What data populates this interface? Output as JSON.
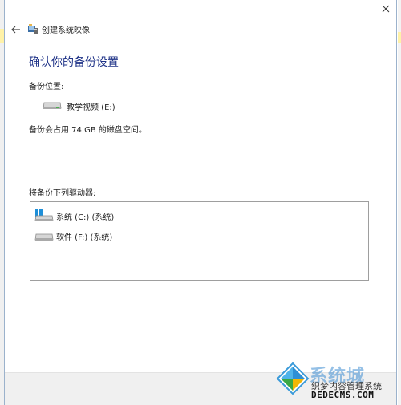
{
  "window": {
    "title": "创建系统映像"
  },
  "main": {
    "heading": "确认你的备份设置",
    "location_label": "备份位置:",
    "location_value": "教学视频 (E:)",
    "usage_text": "备份会占用 74 GB 的磁盘空间。",
    "drives_label": "将备份下列驱动器:",
    "drives": [
      {
        "label": "系统 (C:) (系统)",
        "icon": "windows-drive-icon"
      },
      {
        "label": "软件 (F:) (系统)",
        "icon": "drive-icon"
      }
    ]
  },
  "watermark": {
    "big_text": "系统城",
    "sub_text": "织梦内容管理系统",
    "site_text": "DEDECMS.COM"
  },
  "colors": {
    "heading": "#1e3287",
    "frame_border": "#9bb2cc",
    "footer": "#f0f0f0"
  }
}
